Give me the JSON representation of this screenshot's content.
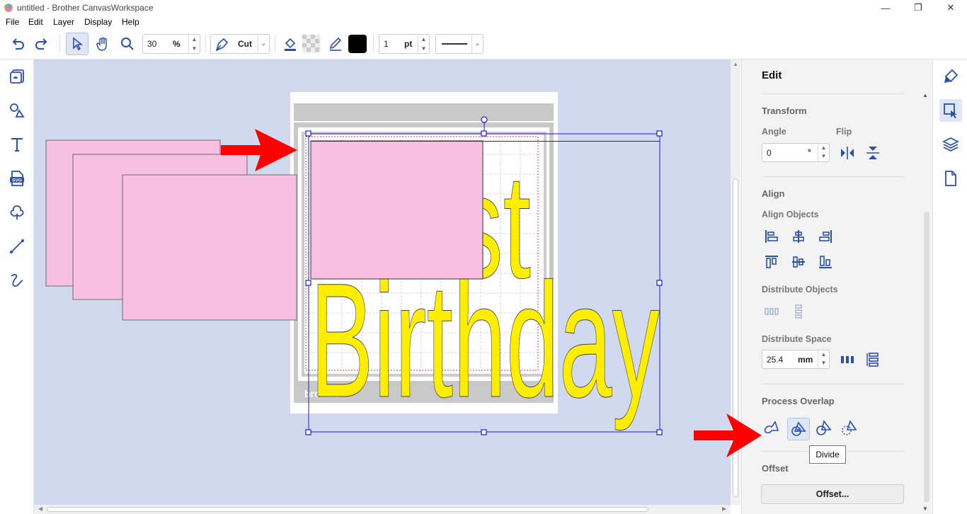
{
  "window": {
    "title": "untitled - Brother CanvasWorkspace",
    "minimize": "—",
    "restore": "❐",
    "close": "✕"
  },
  "menu": [
    "File",
    "Edit",
    "Layer",
    "Display",
    "Help"
  ],
  "toolbar": {
    "zoom_value": "30",
    "zoom_unit": "%",
    "mode_label": "Cut",
    "line_width_value": "1",
    "line_width_unit": "pt"
  },
  "left_tools": [
    "pattern-icon",
    "shapes-icon",
    "text-icon",
    "svg-icon",
    "tree-icon",
    "line-icon",
    "freehand-icon"
  ],
  "canvas": {
    "mat_brand": "brother",
    "birthday_text": "Birthday",
    "upper_text": "st",
    "colors": {
      "canvas_bg": "#d1d9ee",
      "pink": "#f7bfe0",
      "yellow": "#ffee00",
      "selection": "#1a1ad6",
      "arrow": "#ff0000"
    }
  },
  "panel": {
    "title": "Edit",
    "transform": {
      "heading": "Transform",
      "angle_label": "Angle",
      "angle_value": "0",
      "angle_unit": "°",
      "flip_label": "Flip"
    },
    "align": {
      "heading": "Align",
      "align_objects_label": "Align Objects",
      "distribute_objects_label": "Distribute Objects",
      "distribute_space_label": "Distribute Space",
      "space_value": "25.4",
      "space_unit": "mm"
    },
    "process_overlap": {
      "heading": "Process Overlap",
      "tooltip": "Divide"
    },
    "offset": {
      "heading": "Offset",
      "button": "Offset..."
    }
  },
  "right_tabs": [
    "brush-icon",
    "edit-select-icon",
    "layers-icon",
    "page-icon"
  ]
}
